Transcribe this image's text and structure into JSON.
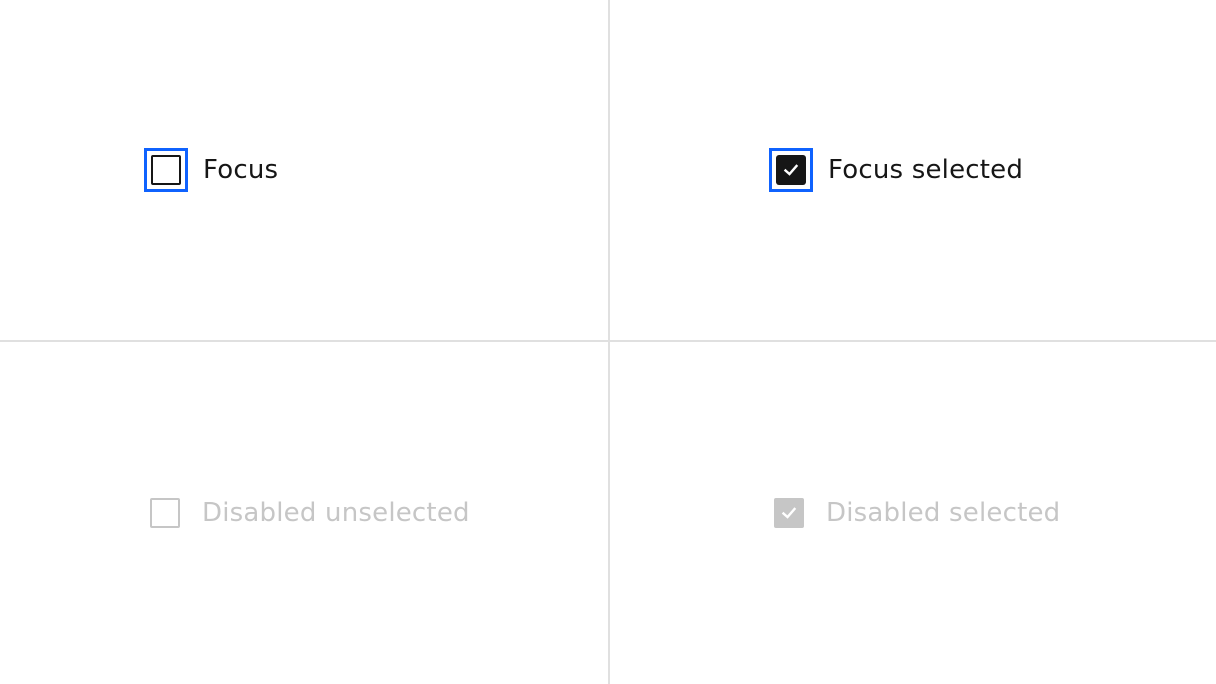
{
  "colors": {
    "focus_ring": "#0f62fe",
    "checkbox_dark": "#161616",
    "disabled": "#c6c6c6",
    "divider": "#e0e0e0",
    "text": "#161616",
    "background": "#ffffff"
  },
  "checkboxes": [
    {
      "label": "Focus",
      "state": "focus",
      "checked": false,
      "disabled": false
    },
    {
      "label": "Focus selected",
      "state": "focus",
      "checked": true,
      "disabled": false
    },
    {
      "label": "Disabled unselected",
      "state": "disabled",
      "checked": false,
      "disabled": true
    },
    {
      "label": "Disabled selected",
      "state": "disabled",
      "checked": true,
      "disabled": true
    }
  ],
  "icons": {
    "check": "checkmark-icon"
  }
}
